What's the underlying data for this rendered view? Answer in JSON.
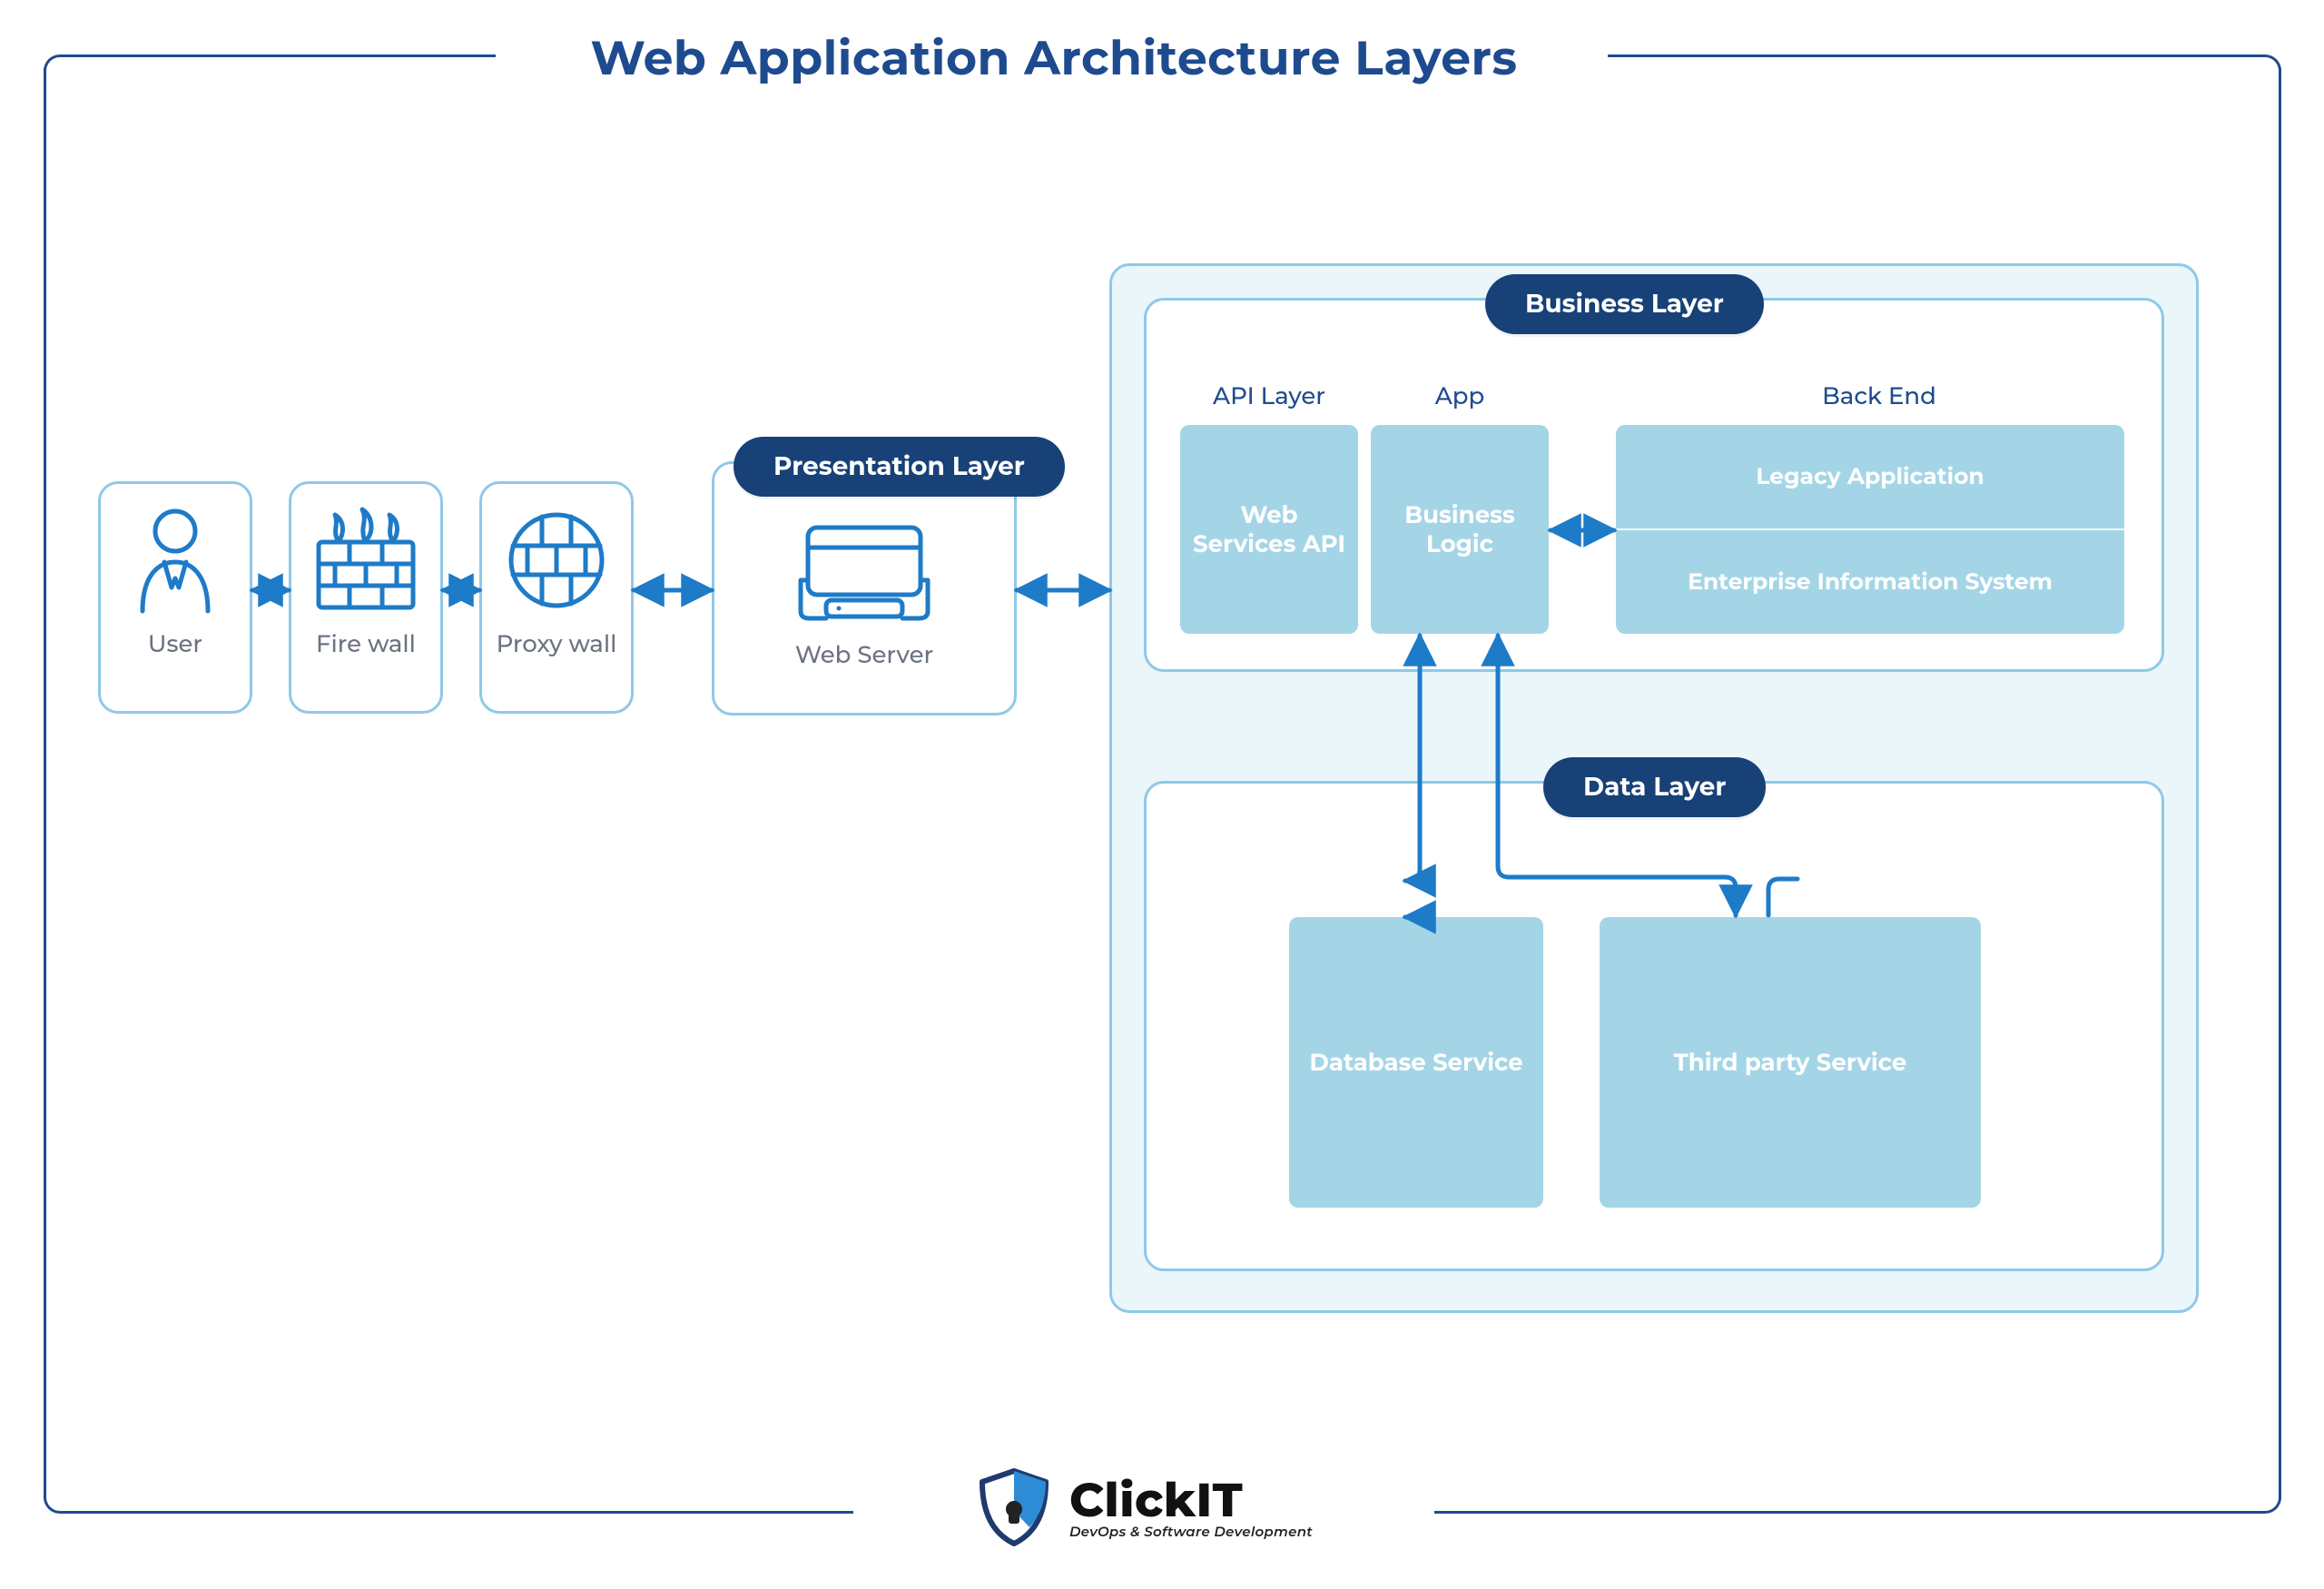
{
  "title": "Web Application Architecture Layers",
  "nodes": {
    "user": "User",
    "firewall": "Fire wall",
    "proxy": "Proxy wall",
    "webserver": "Web Server"
  },
  "layers": {
    "presentation": "Presentation Layer",
    "business": "Business Layer",
    "data": "Data Layer"
  },
  "business": {
    "cols": {
      "api": "API Layer",
      "app": "App",
      "backend": "Back End"
    },
    "tiles": {
      "webservices": "Web Services API",
      "bl": "Business Logic",
      "legacy": "Legacy Application",
      "eis": "Enterprise Information System"
    }
  },
  "data": {
    "db": "Database Service",
    "third": "Third party Service"
  },
  "logo": {
    "name": "ClickIT",
    "tag": "DevOps & Software Development"
  },
  "colors": {
    "navy": "#1E4B8F",
    "stroke": "#1E7BC8",
    "strokeLight": "#8EC9E8",
    "teal": "#A4D5E6"
  }
}
